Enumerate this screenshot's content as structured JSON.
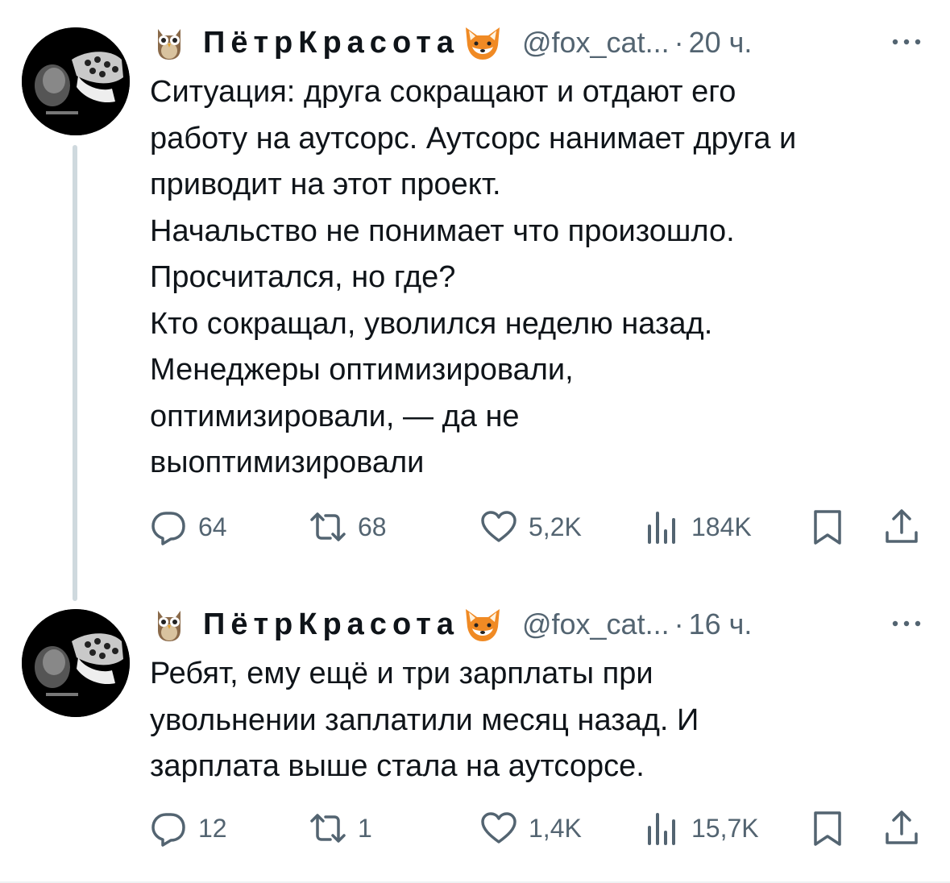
{
  "thread": {
    "tweets": [
      {
        "author": {
          "display_name": "ПётрКрасота",
          "handle": "@fox_cat...",
          "prefix_emoji": "owl",
          "suffix_emoji": "fox-face"
        },
        "separator": "·",
        "time": "20 ч.",
        "text_lines": [
          "Ситуация: друга сокращают и отдают его",
          "работу на аутсорс. Аутсорс нанимает друга и",
          "приводит на этот проект.",
          "Начальство не понимает что произошло.",
          "Просчитался, но где?",
          "Кто сокращал, уволился неделю назад.",
          "Менеджеры оптимизировали,",
          "оптимизировали, — да не",
          "выоптимизировали"
        ],
        "stats": {
          "replies": "64",
          "retweets": "68",
          "likes": "5,2K",
          "views": "184K"
        }
      },
      {
        "author": {
          "display_name": "ПётрКрасота",
          "handle": "@fox_cat...",
          "prefix_emoji": "owl",
          "suffix_emoji": "fox-face"
        },
        "separator": "·",
        "time": "16 ч.",
        "text_lines": [
          "Ребят, ему ещё и три зарплаты при",
          "увольнении заплатили месяц назад. И",
          "зарплата выше стала на аутсорсе."
        ],
        "stats": {
          "replies": "12",
          "retweets": "1",
          "likes": "1,4K",
          "views": "15,7K"
        }
      }
    ]
  },
  "icons": {
    "more": "more-horizontal-icon",
    "reply": "reply-icon",
    "retweet": "retweet-icon",
    "like": "heart-icon",
    "views": "views-icon",
    "bookmark": "bookmark-icon",
    "share": "share-icon"
  },
  "colors": {
    "text": "#0f1419",
    "secondary": "#536471",
    "thread_line": "#cfd9de",
    "background": "#ffffff"
  }
}
